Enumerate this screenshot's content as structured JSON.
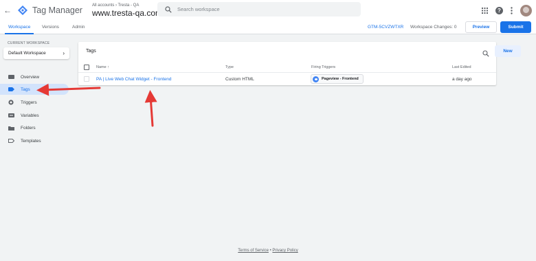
{
  "app": {
    "title": "Tag Manager",
    "breadcrumb": "All accounts › Tresta - QA",
    "container": "www.tresta-qa.com",
    "search_placeholder": "Search workspace"
  },
  "nav": {
    "tabs": [
      {
        "label": "Workspace",
        "active": true
      },
      {
        "label": "Versions",
        "active": false
      },
      {
        "label": "Admin",
        "active": false
      }
    ],
    "workspace_id": "GTM-5CVZWTXR",
    "workspace_changes": "Workspace Changes: 0",
    "preview_label": "Preview",
    "submit_label": "Submit"
  },
  "sidebar": {
    "current_workspace_label": "CURRENT WORKSPACE",
    "workspace_name": "Default Workspace",
    "items": [
      {
        "label": "Overview",
        "icon": "overview-icon",
        "active": false
      },
      {
        "label": "Tags",
        "icon": "tag-icon",
        "active": true
      },
      {
        "label": "Triggers",
        "icon": "trigger-icon",
        "active": false
      },
      {
        "label": "Variables",
        "icon": "variables-icon",
        "active": false
      },
      {
        "label": "Folders",
        "icon": "folder-icon",
        "active": false
      },
      {
        "label": "Templates",
        "icon": "templates-icon",
        "active": false
      }
    ]
  },
  "tags": {
    "title": "Tags",
    "new_label": "New",
    "columns": [
      "Name ↑",
      "Type",
      "Firing Triggers",
      "Last Edited"
    ],
    "rows": [
      {
        "name": "PA | Live Web Chat Widget - Frontend",
        "type": "Custom HTML",
        "trigger": "Pageview - Frontend",
        "last_edited": "a day ago"
      }
    ]
  },
  "footer": {
    "terms": "Terms of Service",
    "separator": "•",
    "privacy": "Privacy Policy"
  },
  "colors": {
    "accent": "#1a73e8",
    "annotation_arrow": "#e53935"
  }
}
